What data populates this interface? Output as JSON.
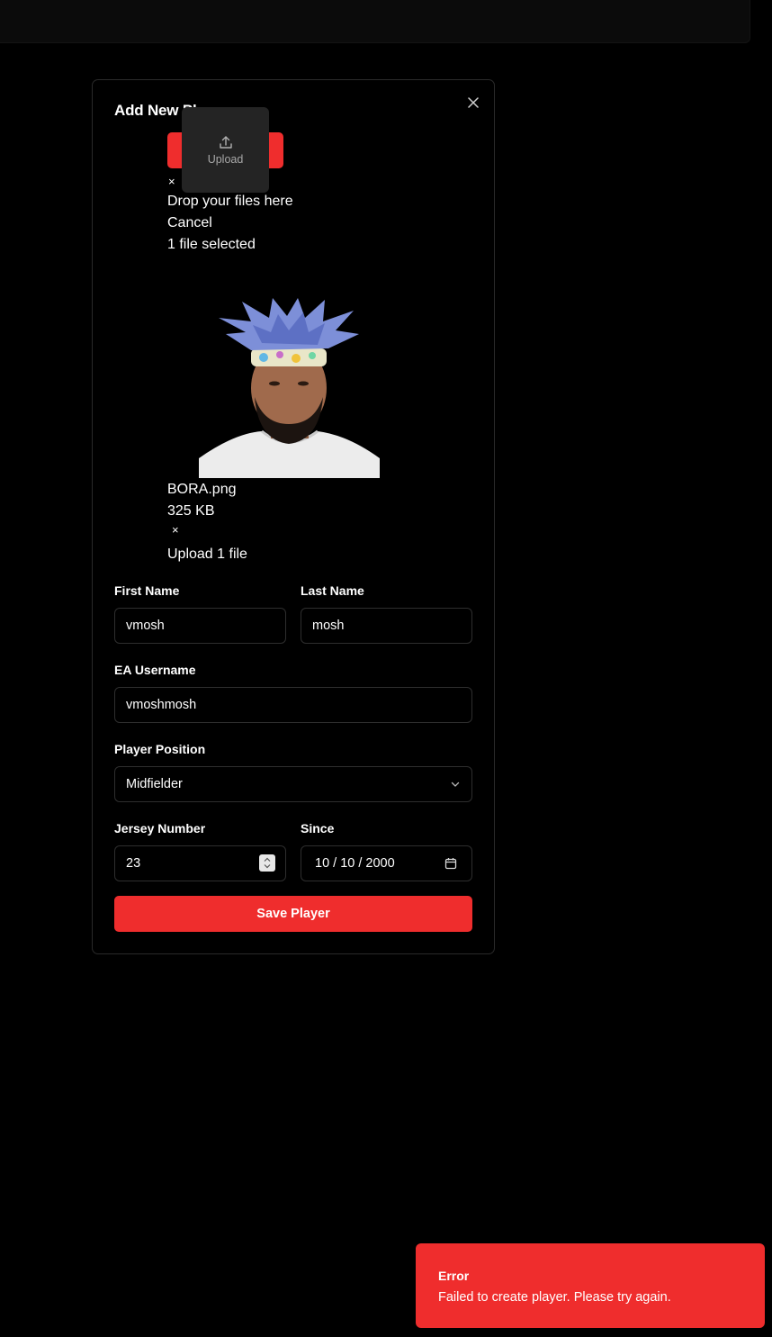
{
  "modal": {
    "title": "Add New Player",
    "close_icon": "close-icon"
  },
  "uploader": {
    "popover_label": "Upload",
    "popover_icon": "upload-icon",
    "remove_all_glyph": "×",
    "drop_text": "Drop your files here",
    "cancel_text": "Cancel",
    "selected_text": "1 file selected",
    "file": {
      "name": "BORA.png",
      "size": "325 KB",
      "remove_glyph": "×"
    },
    "upload_action": "Upload 1 file"
  },
  "form": {
    "first_name": {
      "label": "First Name",
      "value": "vmosh"
    },
    "last_name": {
      "label": "Last Name",
      "value": "mosh"
    },
    "ea_username": {
      "label": "EA Username",
      "value": "vmoshmosh"
    },
    "position": {
      "label": "Player Position",
      "value": "Midfielder",
      "icon": "chevron-down-icon"
    },
    "jersey": {
      "label": "Jersey Number",
      "value": "23"
    },
    "since": {
      "label": "Since",
      "value": "10 / 10 / 2000",
      "icon": "calendar-icon"
    },
    "save_label": "Save Player"
  },
  "toast": {
    "title": "Error",
    "message": "Failed to create player. Please try again."
  },
  "colors": {
    "accent": "#ef2d2d",
    "background": "#000000",
    "border": "#2e2e2e"
  }
}
